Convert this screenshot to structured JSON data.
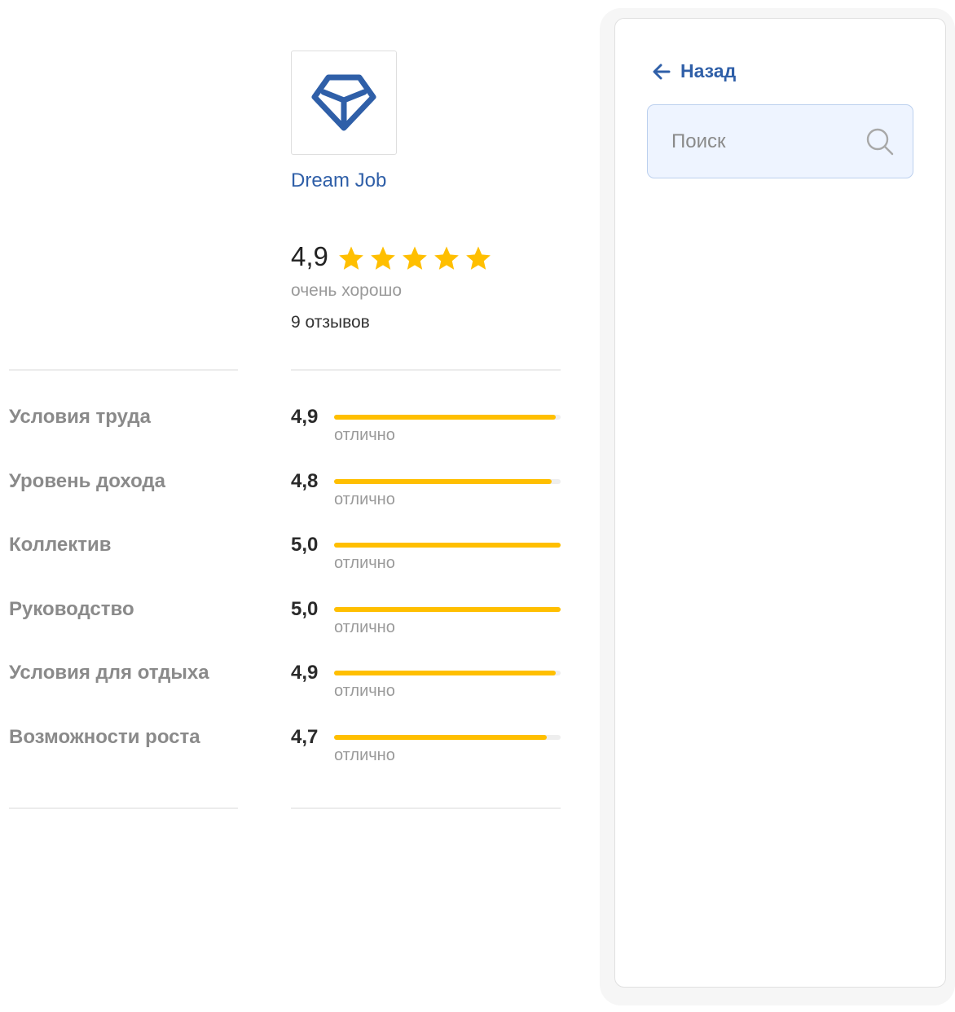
{
  "company": {
    "name": "Dream Job",
    "logo_icon": "dreamjob-logo-icon",
    "brand_color": "#2f5fa8"
  },
  "overall": {
    "score": "4,9",
    "stars": 5,
    "label": "очень хорошо",
    "reviews": "9 отзывов"
  },
  "ratings": [
    {
      "label": "Условия труда",
      "score": "4,9",
      "value": 4.9,
      "word": "отлично"
    },
    {
      "label": "Уровень дохода",
      "score": "4,8",
      "value": 4.8,
      "word": "отлично"
    },
    {
      "label": "Коллектив",
      "score": "5,0",
      "value": 5.0,
      "word": "отлично"
    },
    {
      "label": "Руководство",
      "score": "5,0",
      "value": 5.0,
      "word": "отлично"
    },
    {
      "label": "Условия для отдыха",
      "score": "4,9",
      "value": 4.9,
      "word": "отлично"
    },
    {
      "label": "Возможности роста",
      "score": "4,7",
      "value": 4.7,
      "word": "отлично"
    }
  ],
  "rating_max": 5,
  "accent_color": "#ffbf00",
  "sidebar": {
    "back_label": "Назад",
    "back_icon": "arrow-left-icon",
    "search_placeholder": "Поиск",
    "search_value": "",
    "search_icon": "search-icon"
  }
}
